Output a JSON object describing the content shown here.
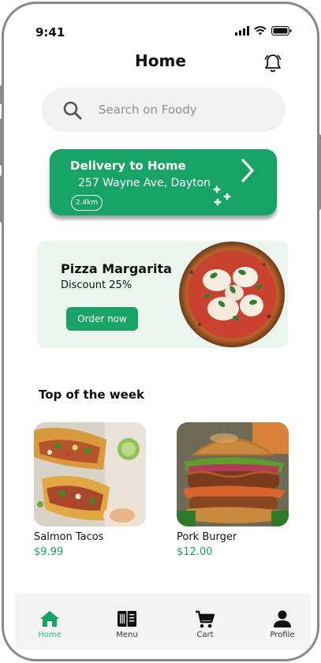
{
  "status_bar": {
    "time": "9:41"
  },
  "header": {
    "title": "Home"
  },
  "search": {
    "placeholder": "Search on Foody"
  },
  "delivery": {
    "title": "Delivery to Home",
    "address": "257 Wayne Ave, Dayton",
    "distance": "2.4km"
  },
  "promo": {
    "name": "Pizza Margarita",
    "discount": "Discount 25%",
    "button": "Order now"
  },
  "section": {
    "title": "Top of the week"
  },
  "items": [
    {
      "name": "Salmon Tacos",
      "price": "$9.99"
    },
    {
      "name": "Pork Burger",
      "price": "$12.00"
    }
  ],
  "tabs": [
    {
      "label": "Home",
      "icon": "home-icon",
      "active": true
    },
    {
      "label": "Menu",
      "icon": "menu-book-icon"
    },
    {
      "label": "Cart",
      "icon": "cart-icon"
    },
    {
      "label": "Profile",
      "icon": "profile-icon"
    }
  ],
  "colors": {
    "accent": "#17a266",
    "promo_bg": "#eaf5ef",
    "tab_active": "#2dbf7a"
  }
}
